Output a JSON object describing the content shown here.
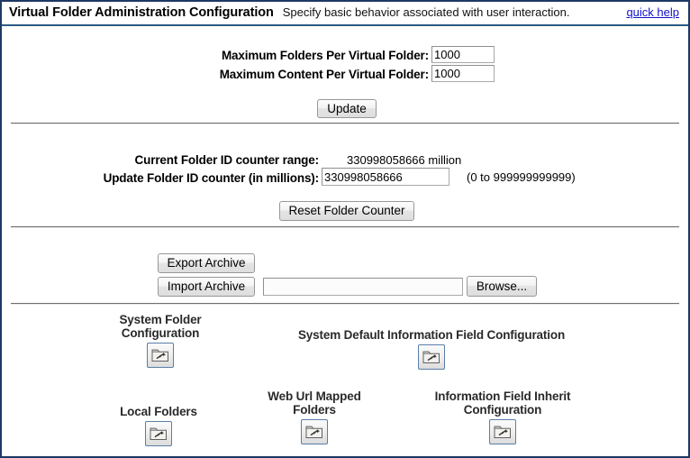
{
  "header": {
    "title": "Virtual Folder Administration Configuration",
    "description": "Specify basic behavior associated with user interaction.",
    "quick_help": "quick help"
  },
  "section_limits": {
    "max_folders_label": "Maximum Folders Per Virtual Folder:",
    "max_folders_value": "1000",
    "max_content_label": "Maximum Content Per Virtual Folder:",
    "max_content_value": "1000",
    "update_button": "Update"
  },
  "section_counter": {
    "current_range_label": "Current Folder ID counter range:",
    "current_range_value": "330998058666 million",
    "update_counter_label": "Update Folder ID counter (in millions):",
    "update_counter_value": "330998058666",
    "range_hint": "(0 to 999999999999)",
    "reset_button": "Reset Folder Counter"
  },
  "section_archive": {
    "export_button": "Export Archive",
    "import_button": "Import Archive",
    "import_file_value": "",
    "import_file_placeholder": "",
    "browse_button": "Browse..."
  },
  "section_links": {
    "items": [
      {
        "label": "System Folder\nConfiguration",
        "icon": "folder-wand-icon"
      },
      {
        "label": "System Default Information Field Configuration",
        "icon": "folder-wand-icon"
      },
      {
        "label": "Local Folders",
        "icon": "folder-wand-icon"
      },
      {
        "label": "Web Url Mapped\nFolders",
        "icon": "folder-wand-icon"
      },
      {
        "label": "Information Field Inherit\nConfiguration",
        "icon": "folder-wand-icon"
      }
    ]
  },
  "colors": {
    "window_border": "#1f3864",
    "header_rule": "#2b5b84",
    "link": "#1111cc",
    "divider": "#6f6f6f",
    "icon_border": "#5a7ea8"
  }
}
